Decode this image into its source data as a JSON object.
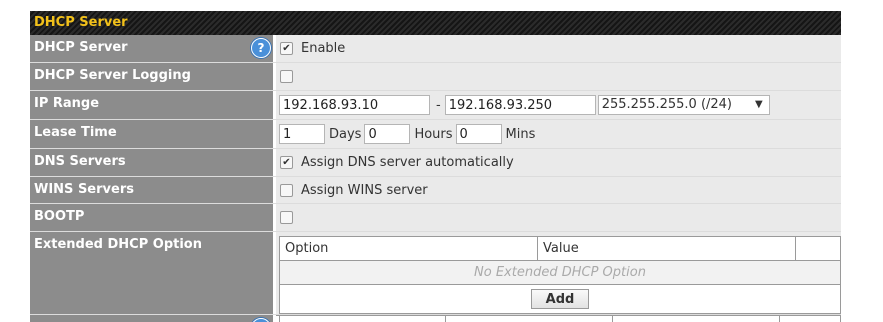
{
  "panel": {
    "title": "DHCP Server"
  },
  "rows": {
    "dhcp_server": {
      "label": "DHCP Server",
      "checked": true,
      "checkbox_label": "Enable",
      "help": "?"
    },
    "logging": {
      "label": "DHCP Server Logging",
      "checked": false
    },
    "ip_range": {
      "label": "IP Range",
      "start": "192.168.93.10",
      "separator": "-",
      "end": "192.168.93.250",
      "mask": "255.255.255.0 (/24)"
    },
    "lease_time": {
      "label": "Lease Time",
      "days_value": "1",
      "days_label": "Days",
      "hours_value": "0",
      "hours_label": "Hours",
      "mins_value": "0",
      "mins_label": "Mins"
    },
    "dns": {
      "label": "DNS Servers",
      "checked": true,
      "checkbox_label": "Assign DNS server automatically"
    },
    "wins": {
      "label": "WINS Servers",
      "checked": false,
      "checkbox_label": "Assign WINS server"
    },
    "bootp": {
      "label": "BOOTP",
      "checked": false
    },
    "extended": {
      "label": "Extended DHCP Option",
      "col_option": "Option",
      "col_value": "Value",
      "empty_text": "No Extended DHCP Option",
      "add_label": "Add"
    }
  },
  "icons": {
    "checked": "checkmark-icon",
    "help": "help-icon",
    "dropdown": "caret-down-icon"
  },
  "colors": {
    "header_text": "#f2c11a",
    "label_bg": "#8c8c8c",
    "value_bg": "#eaeaea",
    "help": "#4a90d9"
  }
}
